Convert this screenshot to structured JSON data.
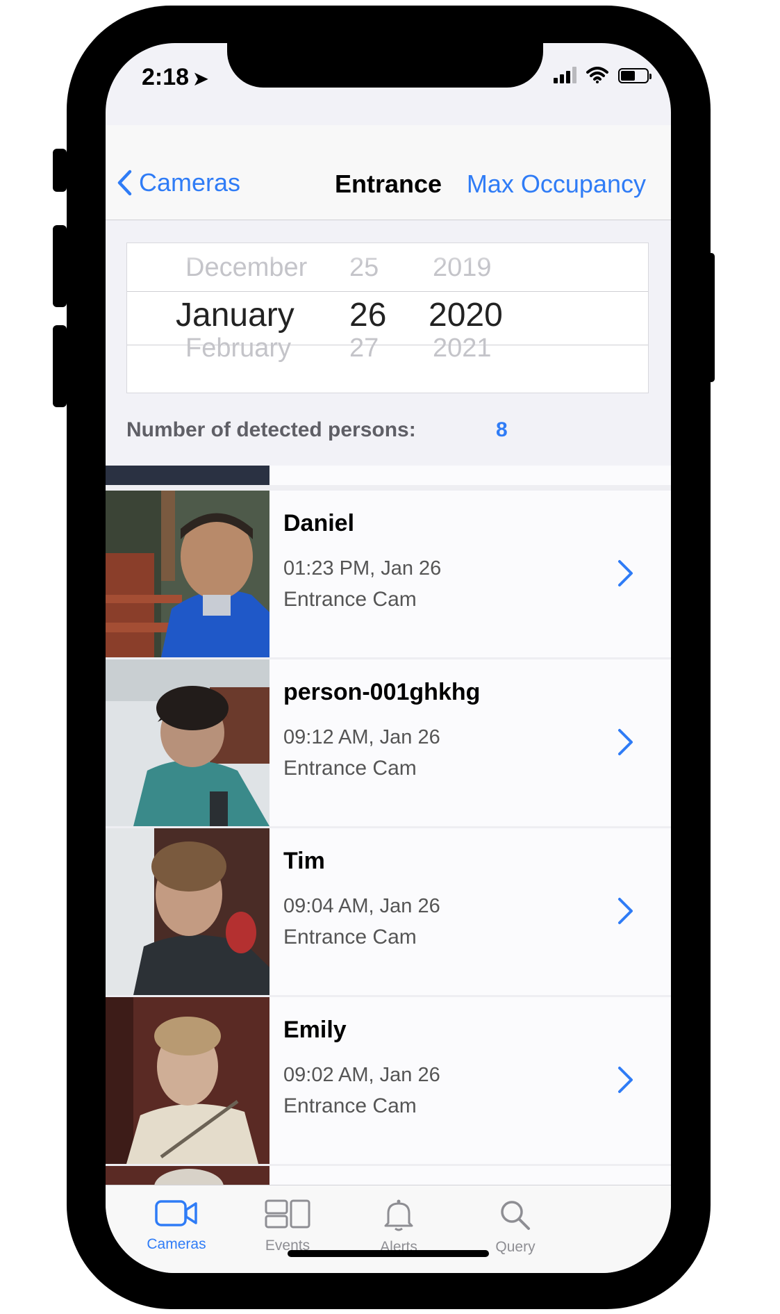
{
  "status_bar": {
    "time": "2:18",
    "location_glyph": "➤"
  },
  "nav": {
    "back_label": "Cameras",
    "title": "Entrance",
    "right_label": "Max Occupancy"
  },
  "picker": {
    "months": [
      "December",
      "January",
      "February"
    ],
    "days": [
      "25",
      "26",
      "27"
    ],
    "years": [
      "2019",
      "2020",
      "2021"
    ]
  },
  "summary": {
    "label": "Number of detected persons:",
    "value": "8"
  },
  "rows": [
    {
      "name": "Daniel",
      "time": "01:23 PM, Jan 26",
      "camera": "Entrance Cam"
    },
    {
      "name": "person-001ghkhg",
      "time": "09:12 AM, Jan 26",
      "camera": "Entrance Cam"
    },
    {
      "name": "Tim",
      "time": "09:04 AM, Jan 26",
      "camera": "Entrance Cam"
    },
    {
      "name": "Emily",
      "time": "09:02 AM, Jan 26",
      "camera": "Entrance Cam"
    }
  ],
  "tabs": [
    {
      "label": "Cameras",
      "icon": "video-camera-icon",
      "active": true
    },
    {
      "label": "Events",
      "icon": "events-icon",
      "active": false
    },
    {
      "label": "Alerts",
      "icon": "bell-icon",
      "active": false
    },
    {
      "label": "Query",
      "icon": "magnifier-icon",
      "active": false
    }
  ],
  "colors": {
    "accent": "#2f7cf6",
    "text": "#000000",
    "secondary": "#555555"
  }
}
